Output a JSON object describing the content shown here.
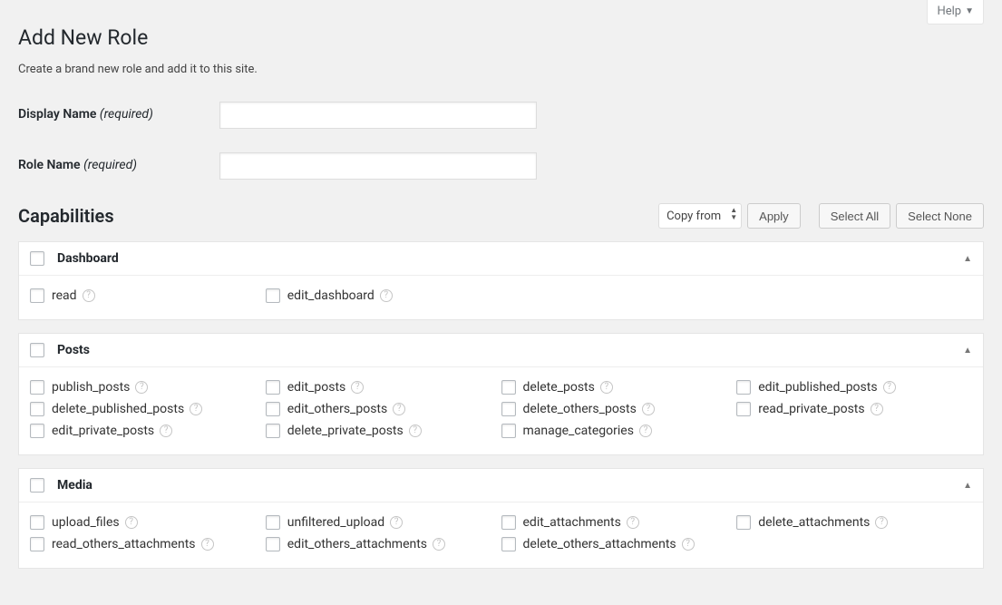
{
  "help": {
    "label": "Help"
  },
  "page": {
    "title": "Add New Role",
    "description": "Create a brand new role and add it to this site."
  },
  "fields": {
    "display_name": {
      "label": "Display Name",
      "required": "(required)",
      "value": ""
    },
    "role_name": {
      "label": "Role Name",
      "required": "(required)",
      "value": ""
    }
  },
  "capabilities": {
    "heading": "Capabilities",
    "copy_from": {
      "placeholder": "Copy from"
    },
    "apply": "Apply",
    "select_all": "Select All",
    "select_none": "Select None",
    "groups": [
      {
        "name": "Dashboard",
        "caps": [
          "read",
          "edit_dashboard"
        ]
      },
      {
        "name": "Posts",
        "caps": [
          "publish_posts",
          "edit_posts",
          "delete_posts",
          "edit_published_posts",
          "delete_published_posts",
          "edit_others_posts",
          "delete_others_posts",
          "read_private_posts",
          "edit_private_posts",
          "delete_private_posts",
          "manage_categories"
        ]
      },
      {
        "name": "Media",
        "caps": [
          "upload_files",
          "unfiltered_upload",
          "edit_attachments",
          "delete_attachments",
          "read_others_attachments",
          "edit_others_attachments",
          "delete_others_attachments"
        ]
      }
    ]
  }
}
